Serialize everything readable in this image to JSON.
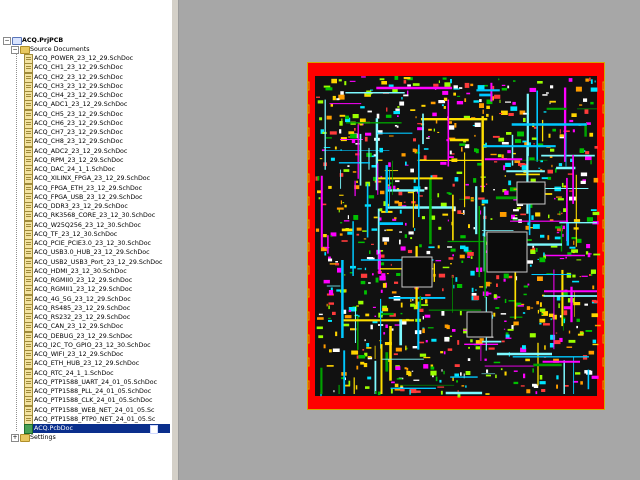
{
  "projects_panel": {
    "project_name": "ACQ.PrjPCB",
    "source_folder": "Source Documents",
    "documents": [
      "ACQ_POWER_23_12_29.SchDoc",
      "ACQ_CH1_23_12_29.SchDoc",
      "ACQ_CH2_23_12_29.SchDoc",
      "ACQ_CH3_23_12_29.SchDoc",
      "ACQ_CH4_23_12_29.SchDoc",
      "ACQ_ADC1_23_12_29.SchDoc",
      "ACQ_CH5_23_12_29.SchDoc",
      "ACQ_CH6_23_12_29.SchDoc",
      "ACQ_CH7_23_12_29.SchDoc",
      "ACQ_CH8_23_12_29.SchDoc",
      "ACQ_ADC2_23_12_29.SchDoc",
      "ACQ_RPM_23_12_29.SchDoc",
      "ACQ_DAC_24_1_1.SchDoc",
      "ACQ_XILINX_FPGA_23_12_29.SchDoc",
      "ACQ_FPGA_ETH_23_12_29.SchDoc",
      "ACQ_FPGA_USB_23_12_29.SchDoc",
      "ACQ_DDR3_23_12_29.SchDoc",
      "ACQ_RK3568_CORE_23_12_30.SchDoc",
      "ACQ_W25Q256_23_12_30.SchDoc",
      "ACQ_TF_23_12_30.SchDoc",
      "ACQ_PCIE_PCIE3.0_23_12_30.SchDoc",
      "ACQ_USB3.0_HUB_23_12_29.SchDoc",
      "ACQ_USB2_USB3_Port_23_12_29.SchDoc",
      "ACQ_HDMI_23_12_30.SchDoc",
      "ACQ_RGMII0_23_12_29.SchDoc",
      "ACQ_RGMII1_23_12_29.SchDoc",
      "ACQ_4G_5G_23_12_29.SchDoc",
      "ACQ_RS485_23_12_29.SchDoc",
      "ACQ_RS232_23_12_29.SchDoc",
      "ACQ_CAN_23_12_29.SchDoc",
      "ACQ_DEBUG_23_12_29.SchDoc",
      "ACQ_I2C_TO_GPIO_23_12_30.SchDoc",
      "ACQ_WIFI_23_12_29.SchDoc",
      "ACQ_ETH_HUB_23_12_29.SchDoc",
      "ACQ_RTC_24_1_1.SchDoc",
      "ACQ_PTP1588_UART_24_01_05.SchDoc",
      "ACQ_PTP1588_PLL_24_01_05.SchDoc",
      "ACQ_PTP1588_CLK_24_01_05.SchDoc",
      "ACQ_PTP1588_WEB_NET_24_01_05.Sc",
      "ACQ_PTP1588_PTP0_NET_24_01_05.Sc"
    ],
    "pcb_document": "ACQ.PcbDoc",
    "settings_folder": "Settings"
  },
  "pcb_view": {
    "board_outline_color": "#d4a800",
    "board_fill_color": "#ff0000",
    "background_color": "#a7a7a7"
  }
}
